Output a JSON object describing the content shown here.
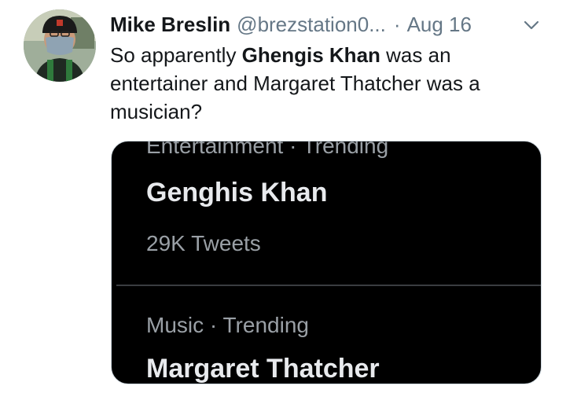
{
  "author": {
    "name": "Mike Breslin",
    "handle": "@brezstation0...",
    "date": "Aug 16"
  },
  "tweet": {
    "text_before": "So apparently ",
    "bold_name": "Ghengis Khan",
    "text_after": " was an entertainer and Margaret Thatcher was a musician?"
  },
  "media": {
    "trends": [
      {
        "meta": "Entertainment · Trending",
        "name": "Genghis Khan",
        "count": "29K Tweets"
      },
      {
        "meta": "Music · Trending",
        "name": "Margaret Thatcher"
      }
    ]
  },
  "icons": {
    "avatar": "profile-photo",
    "caret": "chevron-down-icon"
  }
}
